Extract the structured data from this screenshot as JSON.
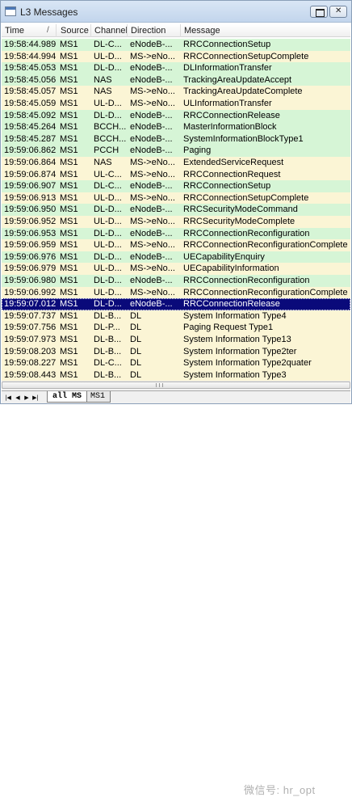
{
  "window": {
    "title": "L3 Messages"
  },
  "columns": [
    "Time",
    "Source",
    "Channel",
    "Direction",
    "Message"
  ],
  "sort_indicator": "/",
  "rows": [
    {
      "time": "19:58:44.989",
      "source": "MS1",
      "channel": "DL-C...",
      "direction": "eNodeB-...",
      "message": "RRCConnectionSetup",
      "style": "green"
    },
    {
      "time": "19:58:44.994",
      "source": "MS1",
      "channel": "UL-D...",
      "direction": "MS->eNo...",
      "message": "RRCConnectionSetupComplete",
      "style": "cream"
    },
    {
      "time": "19:58:45.053",
      "source": "MS1",
      "channel": "DL-D...",
      "direction": "eNodeB-...",
      "message": "DLInformationTransfer",
      "style": "green"
    },
    {
      "time": "19:58:45.056",
      "source": "MS1",
      "channel": "NAS",
      "direction": "eNodeB-...",
      "message": "TrackingAreaUpdateAccept",
      "style": "green"
    },
    {
      "time": "19:58:45.057",
      "source": "MS1",
      "channel": "NAS",
      "direction": "MS->eNo...",
      "message": "TrackingAreaUpdateComplete",
      "style": "cream"
    },
    {
      "time": "19:58:45.059",
      "source": "MS1",
      "channel": "UL-D...",
      "direction": "MS->eNo...",
      "message": "ULInformationTransfer",
      "style": "cream"
    },
    {
      "time": "19:58:45.092",
      "source": "MS1",
      "channel": "DL-D...",
      "direction": "eNodeB-...",
      "message": "RRCConnectionRelease",
      "style": "green"
    },
    {
      "time": "19:58:45.264",
      "source": "MS1",
      "channel": "BCCH...",
      "direction": "eNodeB-...",
      "message": "MasterInformationBlock",
      "style": "green"
    },
    {
      "time": "19:58:45.287",
      "source": "MS1",
      "channel": "BCCH...",
      "direction": "eNodeB-...",
      "message": "SystemInformationBlockType1",
      "style": "green"
    },
    {
      "time": "19:59:06.862",
      "source": "MS1",
      "channel": "PCCH",
      "direction": "eNodeB-...",
      "message": "Paging",
      "style": "green"
    },
    {
      "time": "19:59:06.864",
      "source": "MS1",
      "channel": "NAS",
      "direction": "MS->eNo...",
      "message": "ExtendedServiceRequest",
      "style": "cream"
    },
    {
      "time": "19:59:06.874",
      "source": "MS1",
      "channel": "UL-C...",
      "direction": "MS->eNo...",
      "message": "RRCConnectionRequest",
      "style": "cream"
    },
    {
      "time": "19:59:06.907",
      "source": "MS1",
      "channel": "DL-C...",
      "direction": "eNodeB-...",
      "message": "RRCConnectionSetup",
      "style": "green"
    },
    {
      "time": "19:59:06.913",
      "source": "MS1",
      "channel": "UL-D...",
      "direction": "MS->eNo...",
      "message": "RRCConnectionSetupComplete",
      "style": "cream"
    },
    {
      "time": "19:59:06.950",
      "source": "MS1",
      "channel": "DL-D...",
      "direction": "eNodeB-...",
      "message": "RRCSecurityModeCommand",
      "style": "green"
    },
    {
      "time": "19:59:06.952",
      "source": "MS1",
      "channel": "UL-D...",
      "direction": "MS->eNo...",
      "message": "RRCSecurityModeComplete",
      "style": "cream"
    },
    {
      "time": "19:59:06.953",
      "source": "MS1",
      "channel": "DL-D...",
      "direction": "eNodeB-...",
      "message": "RRCConnectionReconfiguration",
      "style": "green"
    },
    {
      "time": "19:59:06.959",
      "source": "MS1",
      "channel": "UL-D...",
      "direction": "MS->eNo...",
      "message": "RRCConnectionReconfigurationComplete",
      "style": "cream"
    },
    {
      "time": "19:59:06.976",
      "source": "MS1",
      "channel": "DL-D...",
      "direction": "eNodeB-...",
      "message": "UECapabilityEnquiry",
      "style": "green"
    },
    {
      "time": "19:59:06.979",
      "source": "MS1",
      "channel": "UL-D...",
      "direction": "MS->eNo...",
      "message": "UECapabilityInformation",
      "style": "cream"
    },
    {
      "time": "19:59:06.980",
      "source": "MS1",
      "channel": "DL-D...",
      "direction": "eNodeB-...",
      "message": "RRCConnectionReconfiguration",
      "style": "green"
    },
    {
      "time": "19:59:06.992",
      "source": "MS1",
      "channel": "UL-D...",
      "direction": "MS->eNo...",
      "message": "RRCConnectionReconfigurationComplete",
      "style": "cream"
    },
    {
      "time": "19:59:07.012",
      "source": "MS1",
      "channel": "DL-D...",
      "direction": "eNodeB-...",
      "message": "RRCConnectionRelease",
      "style": "selected"
    },
    {
      "time": "19:59:07.737",
      "source": "MS1",
      "channel": "DL-B...",
      "direction": "DL",
      "message": "System Information Type4",
      "style": "cream"
    },
    {
      "time": "19:59:07.756",
      "source": "MS1",
      "channel": "DL-P...",
      "direction": "DL",
      "message": "Paging Request Type1",
      "style": "cream"
    },
    {
      "time": "19:59:07.973",
      "source": "MS1",
      "channel": "DL-B...",
      "direction": "DL",
      "message": "System Information Type13",
      "style": "cream"
    },
    {
      "time": "19:59:08.203",
      "source": "MS1",
      "channel": "DL-B...",
      "direction": "DL",
      "message": "System Information Type2ter",
      "style": "cream"
    },
    {
      "time": "19:59:08.227",
      "source": "MS1",
      "channel": "DL-C...",
      "direction": "DL",
      "message": "System Information Type2quater",
      "style": "cream"
    },
    {
      "time": "19:59:08.443",
      "source": "MS1",
      "channel": "DL-B...",
      "direction": "DL",
      "message": "System Information Type3",
      "style": "cream"
    }
  ],
  "tabs": [
    "all MS",
    "MS1"
  ],
  "watermark": "微信号: hr_opt",
  "colors": {
    "row_green": "#d6f5d6",
    "row_cream": "#fbf5d5",
    "selection": "#0a0a7a"
  },
  "icons": [
    "window-icon",
    "restore-icon",
    "close-icon",
    "first-icon",
    "prev-icon",
    "next-icon",
    "last-icon"
  ]
}
